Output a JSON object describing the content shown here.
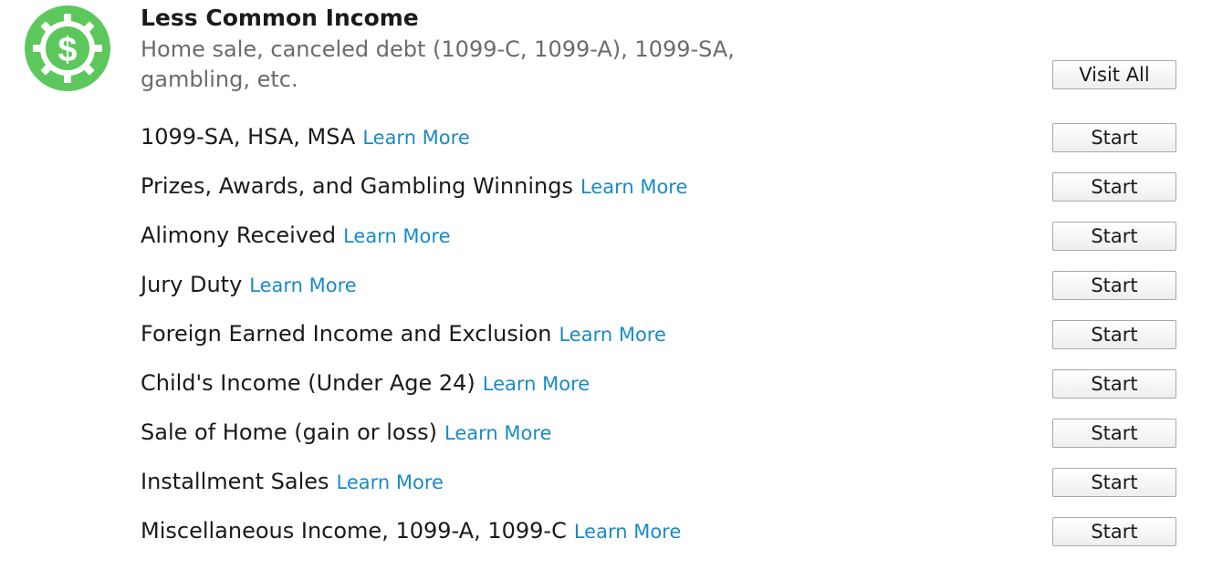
{
  "section": {
    "icon": "dollar-gear-icon",
    "icon_color": "#5cc85c",
    "title": "Less Common Income",
    "subtitle": "Home sale, canceled debt (1099-C, 1099-A), 1099-SA, gambling, etc.",
    "visit_all_label": "Visit All"
  },
  "link_color": "#1a8ac6",
  "items": [
    {
      "label": "1099-SA, HSA, MSA",
      "link": "Learn More",
      "button": "Start"
    },
    {
      "label": "Prizes, Awards, and Gambling Winnings",
      "link": "Learn More",
      "button": "Start"
    },
    {
      "label": "Alimony Received",
      "link": "Learn More",
      "button": "Start"
    },
    {
      "label": "Jury Duty",
      "link": "Learn More",
      "button": "Start"
    },
    {
      "label": "Foreign Earned Income and Exclusion",
      "link": "Learn More",
      "button": "Start"
    },
    {
      "label": "Child's Income (Under Age 24)",
      "link": "Learn More",
      "button": "Start"
    },
    {
      "label": "Sale of Home (gain or loss)",
      "link": "Learn More",
      "button": "Start"
    },
    {
      "label": "Installment Sales",
      "link": "Learn More",
      "button": "Start"
    },
    {
      "label": "Miscellaneous Income, 1099-A, 1099-C",
      "link": "Learn More",
      "button": "Start"
    }
  ]
}
